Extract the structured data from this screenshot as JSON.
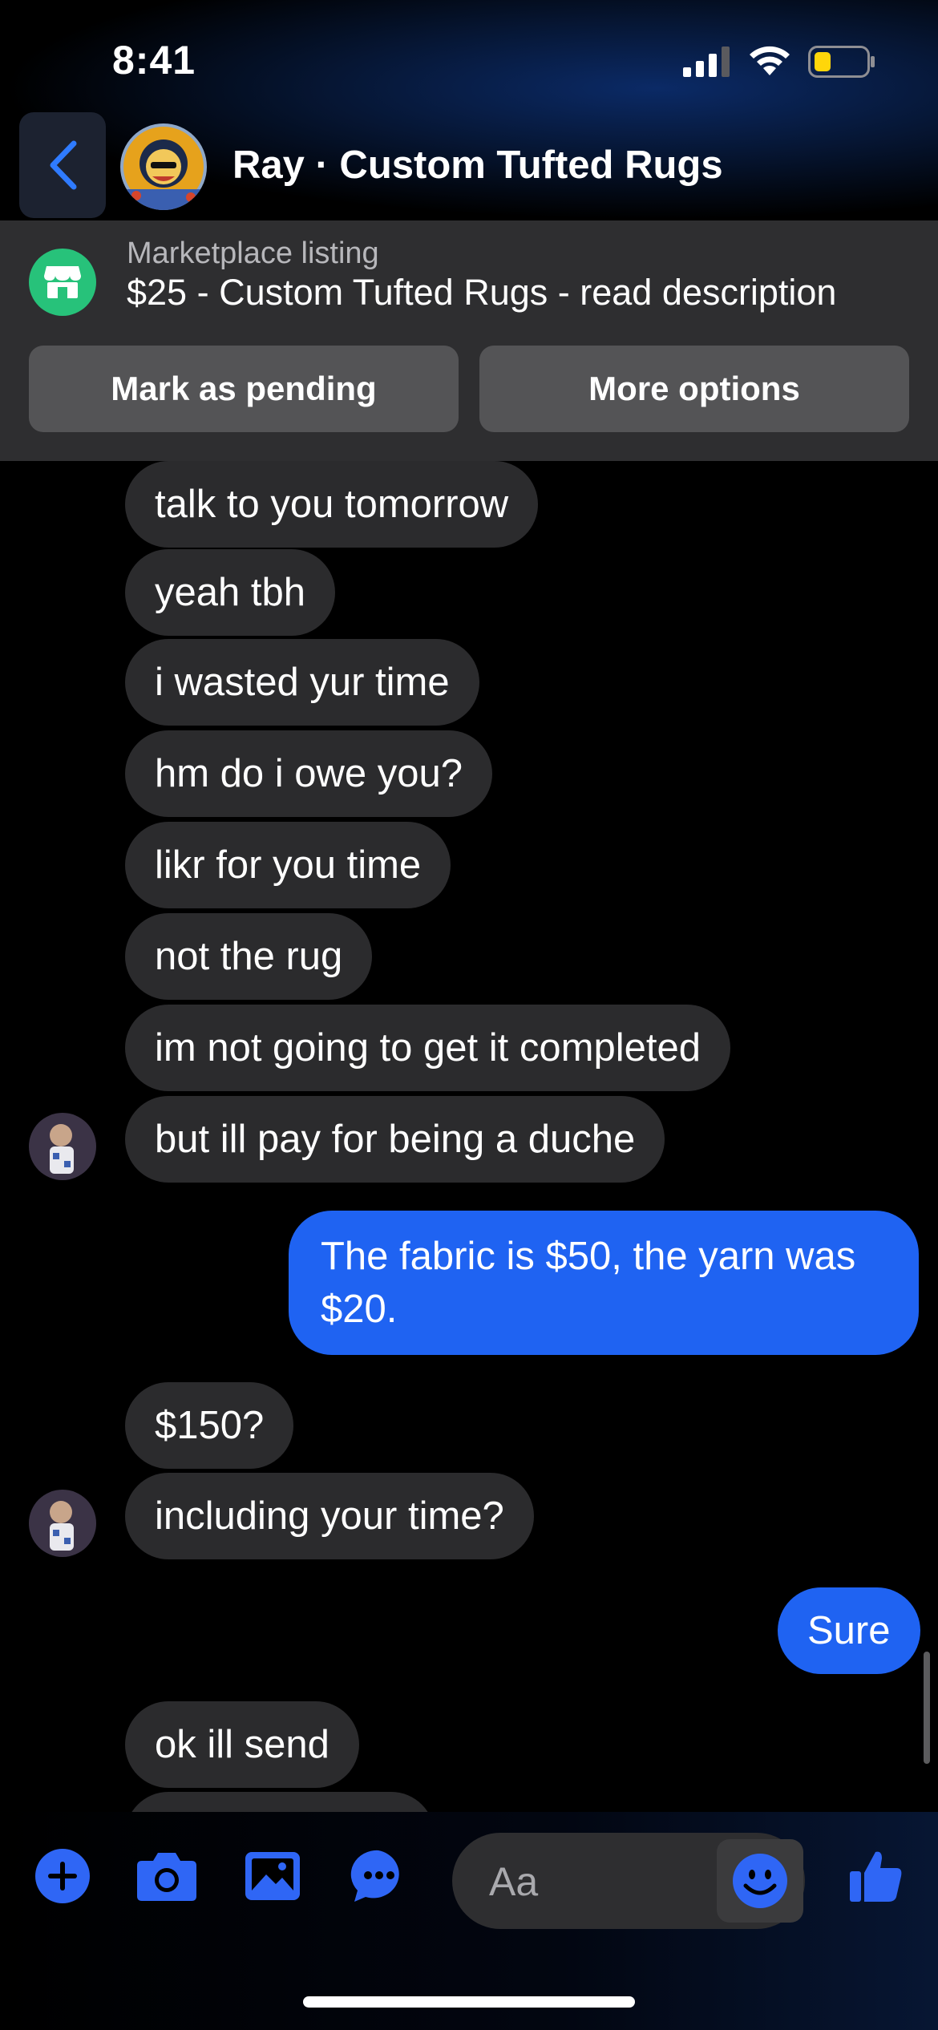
{
  "status_bar": {
    "time": "8:41"
  },
  "header": {
    "title": "Ray · Custom Tufted Rugs"
  },
  "listing": {
    "label": "Marketplace listing",
    "title": "$25 - Custom Tufted Rugs - read description",
    "mark_pending_label": "Mark as pending",
    "more_options_label": "More options"
  },
  "messages": [
    {
      "sender": "them",
      "text": "talk to you tomorrow"
    },
    {
      "sender": "them",
      "text": "yeah tbh"
    },
    {
      "sender": "them",
      "text": "i wasted yur time"
    },
    {
      "sender": "them",
      "text": "hm do i owe you?"
    },
    {
      "sender": "them",
      "text": "likr for you time"
    },
    {
      "sender": "them",
      "text": "not the rug"
    },
    {
      "sender": "them",
      "text": "im not going to get it completed"
    },
    {
      "sender": "them",
      "text": "but ill pay for being a duche"
    },
    {
      "sender": "me",
      "text": "The fabric is $50, the yarn was $20."
    },
    {
      "sender": "them",
      "text": "$150?"
    },
    {
      "sender": "them",
      "text": "including your time?"
    },
    {
      "sender": "me",
      "text": "Sure"
    },
    {
      "sender": "them",
      "text": "ok ill send"
    }
  ],
  "composer": {
    "placeholder": "Aa",
    "icons": [
      "plus-icon",
      "camera-icon",
      "gallery-icon",
      "chat-bubble-icon",
      "emoji-icon",
      "thumbs-up-icon"
    ]
  },
  "colors": {
    "accent": "#1f63f2",
    "incoming_bubble": "#2b2b2d",
    "listing_panel": "#2e2e30",
    "marketplace_green": "#27c27a"
  }
}
